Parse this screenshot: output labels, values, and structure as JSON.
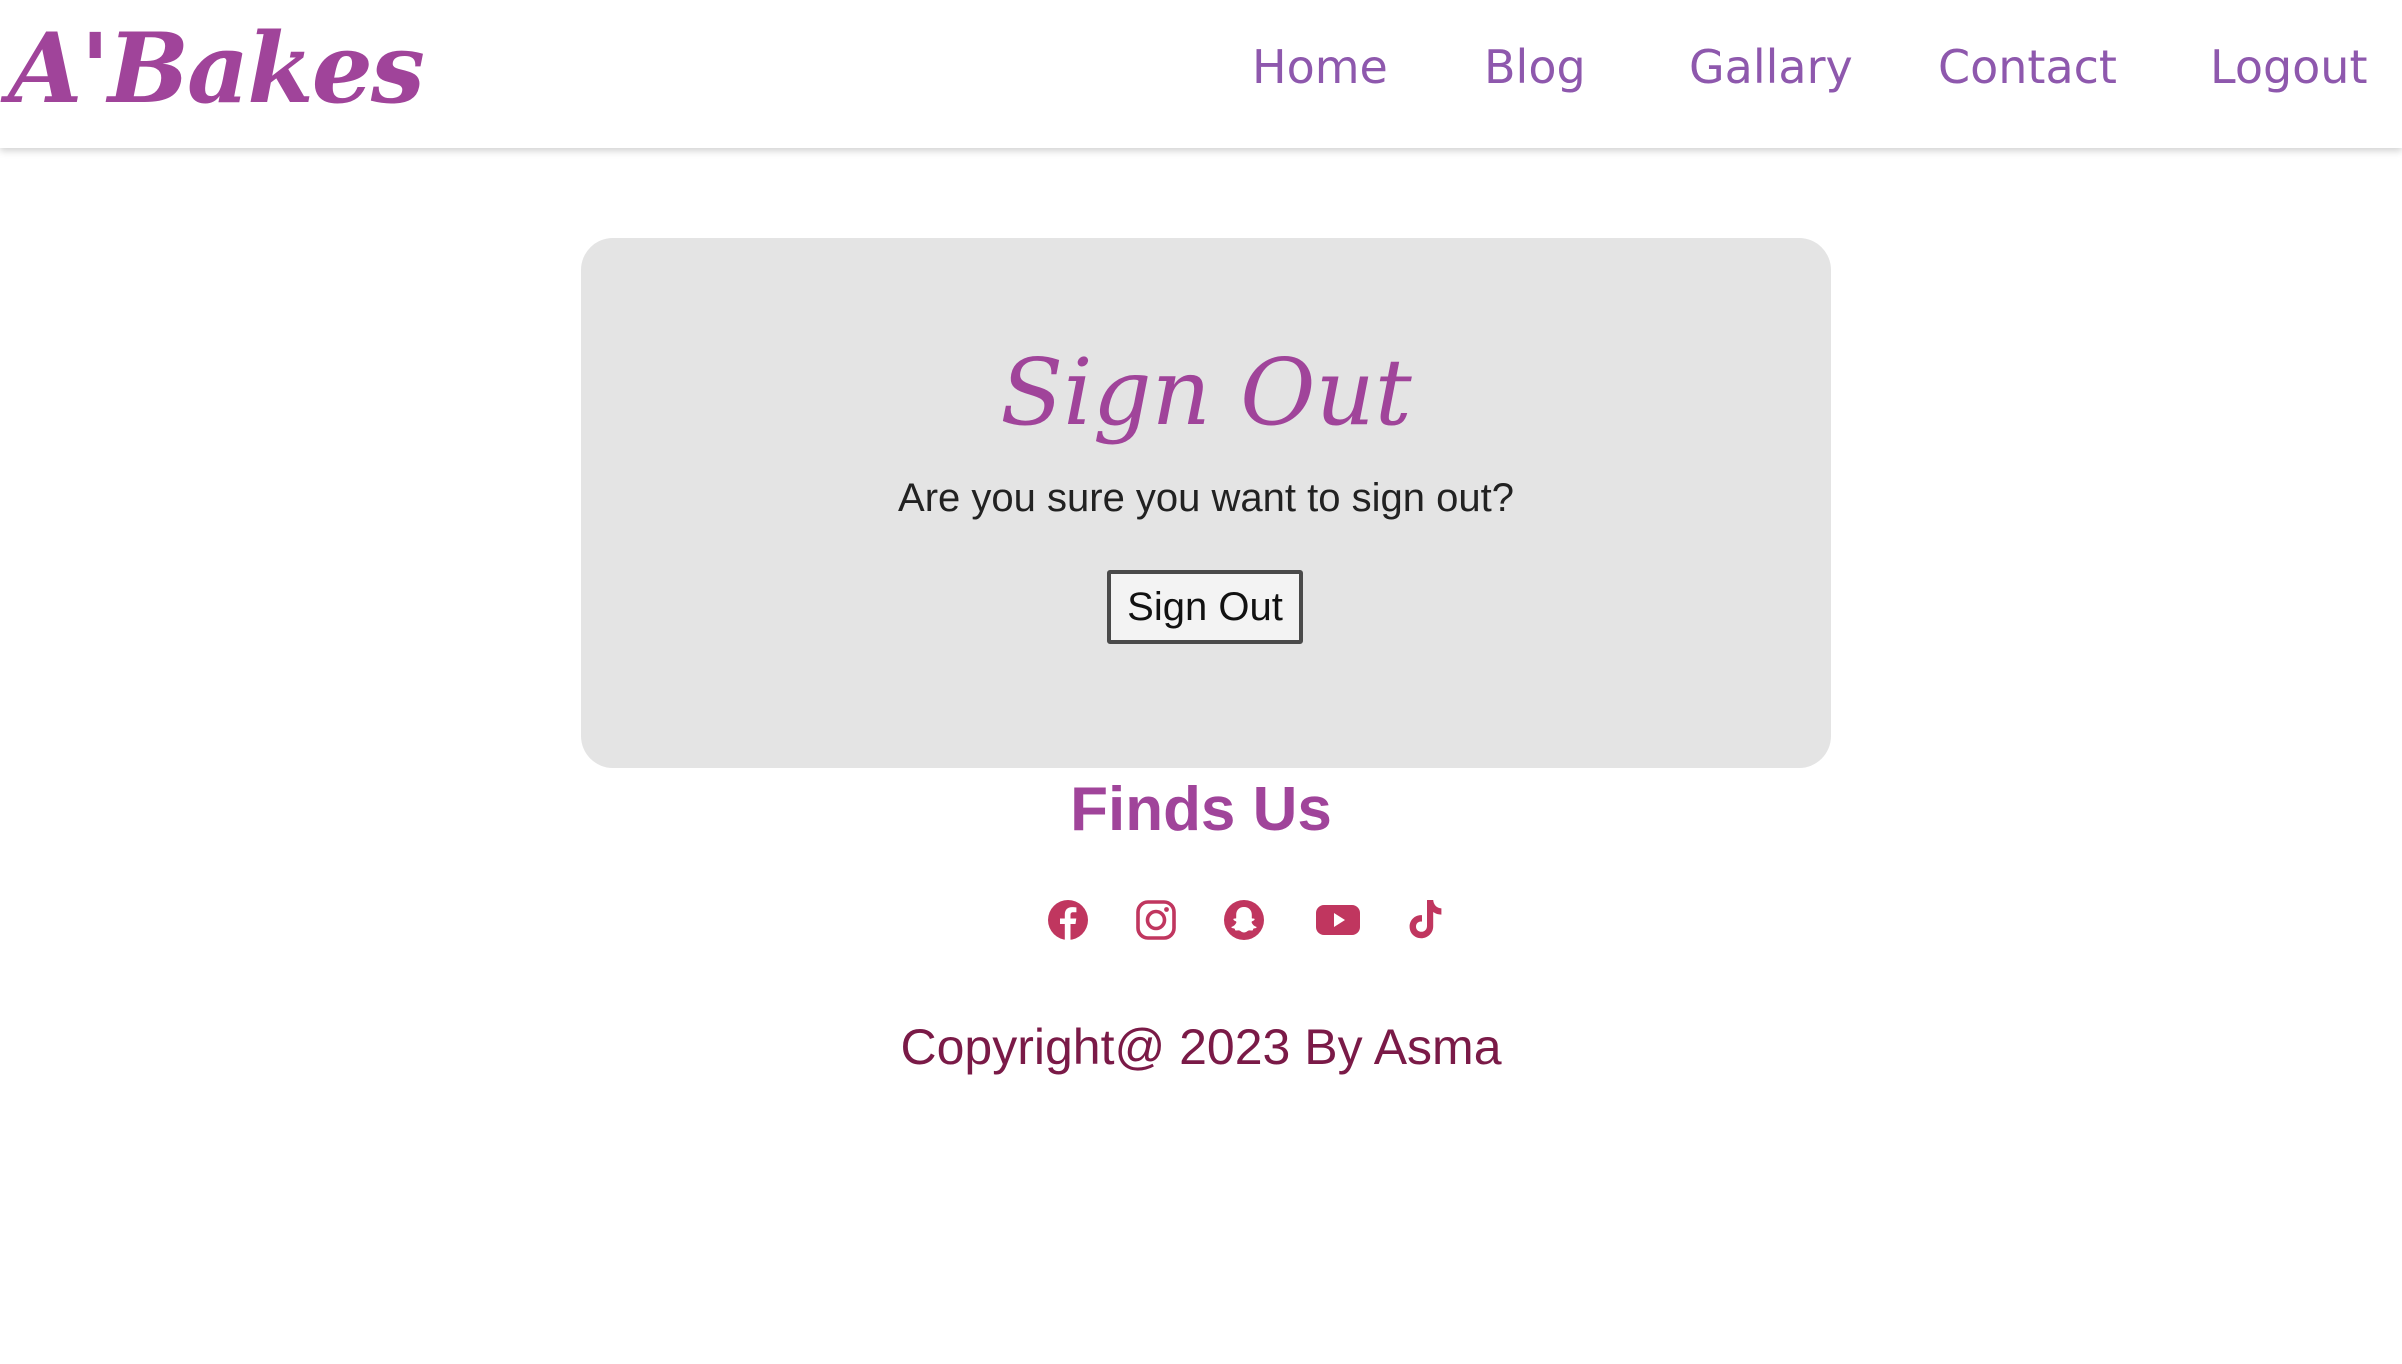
{
  "header": {
    "brand": "A'Bakes",
    "nav": [
      {
        "label": "Home"
      },
      {
        "label": "Blog"
      },
      {
        "label": "Gallary"
      },
      {
        "label": "Contact"
      },
      {
        "label": "Logout"
      }
    ]
  },
  "card": {
    "title": "Sign Out",
    "message": "Are you sure you want to sign out?",
    "button_label": "Sign Out"
  },
  "footer": {
    "heading": "Finds Us",
    "socials": [
      {
        "icon": "facebook-icon"
      },
      {
        "icon": "instagram-icon"
      },
      {
        "icon": "snapchat-icon"
      },
      {
        "icon": "youtube-icon"
      },
      {
        "icon": "tiktok-icon"
      }
    ],
    "copyright": "Copyright@ 2023 By Asma"
  },
  "colors": {
    "brand": "#a0449a",
    "nav": "#8e58ad",
    "social": "#c0365f",
    "copyright": "#7a1a47",
    "card_bg": "#e4e4e4"
  }
}
